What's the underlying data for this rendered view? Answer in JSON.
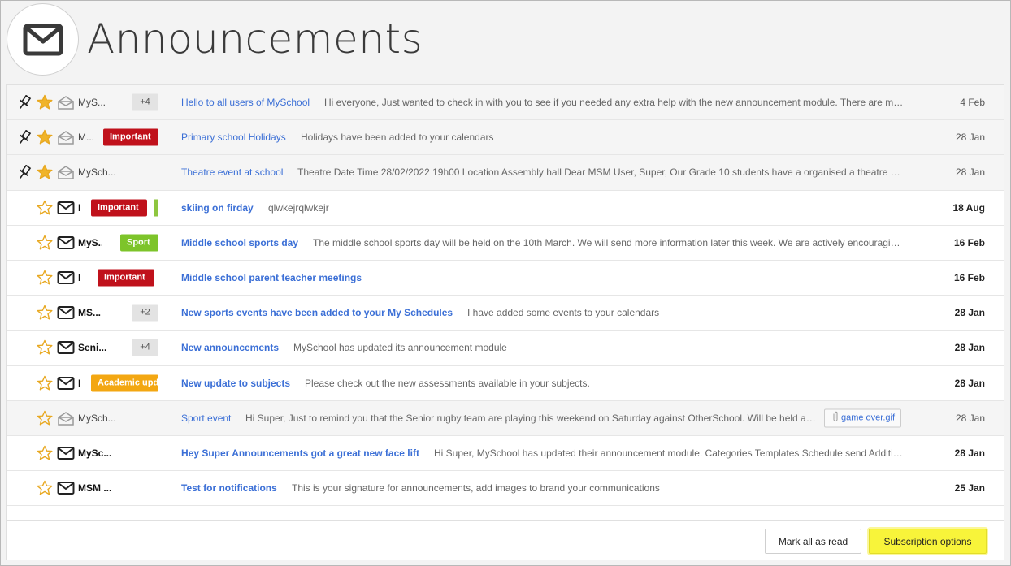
{
  "header": {
    "title": "Announcements",
    "icon": "envelope-icon"
  },
  "badge_colors": {
    "Important": "#c0111b",
    "Sport": "#7dc42a",
    "Academic": "#f3a712"
  },
  "accent": "#3b6fd6",
  "rows": [
    {
      "pinned": true,
      "starred": true,
      "read": true,
      "sender": "MyS...",
      "count": "+4",
      "badge": "",
      "subject": "Hello to all users of MySchool",
      "preview": "Hi everyone, Just wanted to check in with you to see if you needed any extra help with the new announcement module. There are many usefu...",
      "date": "4 Feb"
    },
    {
      "pinned": true,
      "starred": true,
      "read": true,
      "sender": "M...",
      "count": "",
      "badge": "Important",
      "subject": "Primary school Holidays",
      "preview": "Holidays have been added to your calendars",
      "date": "28 Jan"
    },
    {
      "pinned": true,
      "starred": true,
      "read": true,
      "sender": "MySch...",
      "count": "",
      "badge": "",
      "subject": "Theatre event at school",
      "preview": "Theatre  Date Time 28/02/2022 19h00 Location Assembly hall    Dear MSM User, Super, Our Grade 10 students have a organised a theatre evenin...",
      "date": "28 Jan"
    },
    {
      "pinned": false,
      "starred": false,
      "read": false,
      "sender": "I",
      "count": "",
      "badge": "Important",
      "greenbar": true,
      "subject": "skiing on firday",
      "preview": "qlwkejrqlwkejr",
      "date": "18 Aug"
    },
    {
      "pinned": false,
      "starred": false,
      "read": false,
      "sender": "MyS...",
      "count": "",
      "badge": "Sport",
      "subject": "Middle school sports day",
      "preview": "The middle school sports day will be held on the 10th March. We will send more information later this week. We are actively encouraging guardi...",
      "date": "16 Feb"
    },
    {
      "pinned": false,
      "starred": false,
      "read": false,
      "sender": "I",
      "count": "",
      "badge": "Important",
      "subject": "Middle school parent teacher meetings",
      "preview": "",
      "date": "16 Feb"
    },
    {
      "pinned": false,
      "starred": false,
      "read": false,
      "sender": "MS...",
      "count": "+2",
      "badge": "",
      "subject": "New sports events have been added to your My Schedules",
      "preview": "I have added some events to your calendars",
      "date": "28 Jan"
    },
    {
      "pinned": false,
      "starred": false,
      "read": false,
      "sender": "Seni...",
      "count": "+4",
      "badge": "",
      "subject": "New announcements",
      "preview": "MySchool has updated its announcement module",
      "date": "28 Jan"
    },
    {
      "pinned": false,
      "starred": false,
      "read": false,
      "sender": "I",
      "count": "",
      "badge": "Academic upda",
      "badge_kind": "Academic",
      "subject": "New update to subjects",
      "preview": "Please check out the new assessments available in your subjects.",
      "date": "28 Jan"
    },
    {
      "pinned": false,
      "starred": false,
      "read": true,
      "sender": "MySch...",
      "count": "",
      "badge": "",
      "subject": "Sport event",
      "preview": "Hi Super,   Just to remind you that the Senior rugby team are playing this weekend on Saturday against OtherSchool. Will be held at our ...",
      "attachment": "game over.gif",
      "date": "28 Jan"
    },
    {
      "pinned": false,
      "starred": false,
      "read": false,
      "sender": "MySc...",
      "count": "",
      "badge": "",
      "subject": "Hey Super Announcements got a great new face lift",
      "preview": "Hi Super, MySchool has updated their announcement module. Categories Templates Schedule send Additional admin...",
      "date": "28 Jan"
    },
    {
      "pinned": false,
      "starred": false,
      "read": false,
      "sender": "MSM ...",
      "count": "",
      "badge": "",
      "subject": "Test for notifications",
      "preview": "This is your signature for announcements, add images to brand your communications",
      "date": "25 Jan"
    }
  ],
  "footer": {
    "mark_all_label": "Mark all as read",
    "subscription_label": "Subscription options"
  }
}
